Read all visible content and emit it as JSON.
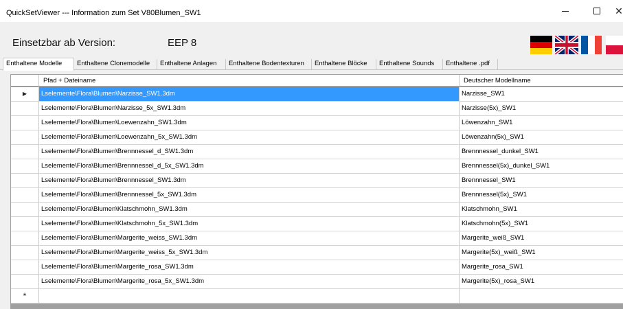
{
  "window": {
    "title": "QuickSetViewer --- Information zum Set V80Blumen_SW1",
    "controls": {
      "minimize": "minimize-icon",
      "maximize": "maximize-icon",
      "close": "close-icon"
    }
  },
  "info": {
    "version_label": "Einsetzbar ab Version:",
    "version_value": "EEP 8"
  },
  "flags": [
    "german-flag-icon",
    "uk-flag-icon",
    "french-flag-icon",
    "polish-flag-icon"
  ],
  "tabs": [
    {
      "label": "Enthaltene Modelle",
      "active": true
    },
    {
      "label": "Enthaltene Clonemodelle"
    },
    {
      "label": "Enthaltene Anlagen"
    },
    {
      "label": "Enthaltene Bodentexturen"
    },
    {
      "label": "Enthaltene Blöcke"
    },
    {
      "label": "Enthaltene Sounds"
    },
    {
      "label": "Enthaltene .pdf"
    }
  ],
  "grid": {
    "columns": [
      "Pfad + Dateiname",
      "Deutscher Modellname"
    ],
    "current_row_marker": "▶",
    "new_row_marker": "*",
    "rows": [
      [
        "Lselemente\\Flora\\Blumen\\Narzisse_SW1.3dm",
        "Narzisse_SW1"
      ],
      [
        "Lselemente\\Flora\\Blumen\\Narzisse_5x_SW1.3dm",
        "Narzisse(5x)_SW1"
      ],
      [
        "Lselemente\\Flora\\Blumen\\Loewenzahn_SW1.3dm",
        "Löwenzahn_SW1"
      ],
      [
        "Lselemente\\Flora\\Blumen\\Loewenzahn_5x_SW1.3dm",
        "Löwenzahn(5x)_SW1"
      ],
      [
        "Lselemente\\Flora\\Blumen\\Brennnessel_d_SW1.3dm",
        "Brennnessel_dunkel_SW1"
      ],
      [
        "Lselemente\\Flora\\Blumen\\Brennnessel_d_5x_SW1.3dm",
        "Brennnessel(5x)_dunkel_SW1"
      ],
      [
        "Lselemente\\Flora\\Blumen\\Brennnessel_SW1.3dm",
        "Brennnessel_SW1"
      ],
      [
        "Lselemente\\Flora\\Blumen\\Brennnessel_5x_SW1.3dm",
        "Brennnessel(5x)_SW1"
      ],
      [
        "Lselemente\\Flora\\Blumen\\Klatschmohn_SW1.3dm",
        "Klatschmohn_SW1"
      ],
      [
        "Lselemente\\Flora\\Blumen\\Klatschmohn_5x_SW1.3dm",
        "Klatschmohn(5x)_SW1"
      ],
      [
        "Lselemente\\Flora\\Blumen\\Margerite_weiss_SW1.3dm",
        "Margerite_weiß_SW1"
      ],
      [
        "Lselemente\\Flora\\Blumen\\Margerite_weiss_5x_SW1.3dm",
        "Margerite(5x)_weiß_SW1"
      ],
      [
        "Lselemente\\Flora\\Blumen\\Margerite_rosa_SW1.3dm",
        "Margerite_rosa_SW1"
      ],
      [
        "Lselemente\\Flora\\Blumen\\Margerite_rosa_5x_SW1.3dm",
        "Margerite(5x)_rosa_SW1"
      ]
    ],
    "selected_row": 0
  },
  "colors": {
    "selection": "#3399ff",
    "de_black": "#000000",
    "de_red": "#dd0000",
    "de_gold": "#ffce00",
    "uk_blue": "#012169",
    "uk_red": "#c8102e",
    "fr_blue": "#0055a4",
    "fr_red": "#ef4135",
    "pl_red": "#dc143c"
  }
}
